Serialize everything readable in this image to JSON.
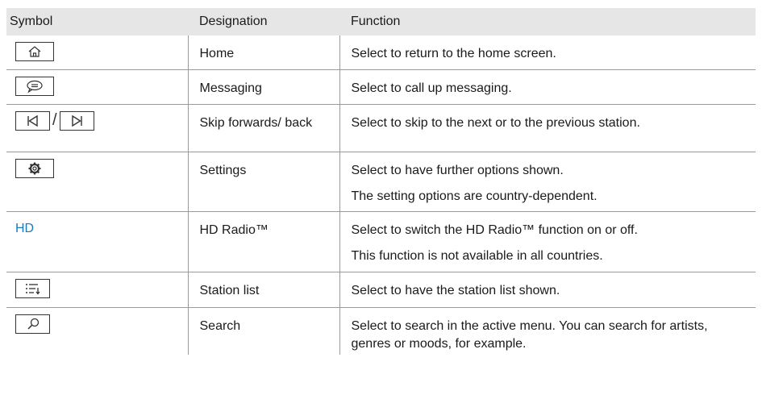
{
  "headers": {
    "symbol": "Symbol",
    "designation": "Designation",
    "function": "Function"
  },
  "rows": [
    {
      "icon": "home-icon",
      "designation": "Home",
      "function": [
        "Select to return to the home screen."
      ]
    },
    {
      "icon": "messaging-icon",
      "designation": "Messaging",
      "function": [
        "Select to call up messaging."
      ]
    },
    {
      "icon": [
        "skip-back-icon",
        "skip-forward-icon"
      ],
      "separator": "/",
      "designation": "Skip forwards/ back",
      "function": [
        "Select to skip to the next or to the previous station."
      ]
    },
    {
      "icon": "settings-icon",
      "designation": "Settings",
      "function": [
        "Select to have further options shown.",
        "The setting options are country-dependent."
      ]
    },
    {
      "symbol_text": "HD",
      "symbol_color": "#1a7bb9",
      "designation": "HD Radio™",
      "function": [
        "Select to switch the HD Radio™ function on or off.",
        "This function is not available in all countries."
      ]
    },
    {
      "icon": "station-list-icon",
      "designation": "Station list",
      "function": [
        "Select to have the station list shown."
      ]
    },
    {
      "icon": "search-icon",
      "designation": "Search",
      "function": [
        "Select to search in the active menu. You can search for artists, genres or moods, for example."
      ]
    }
  ]
}
